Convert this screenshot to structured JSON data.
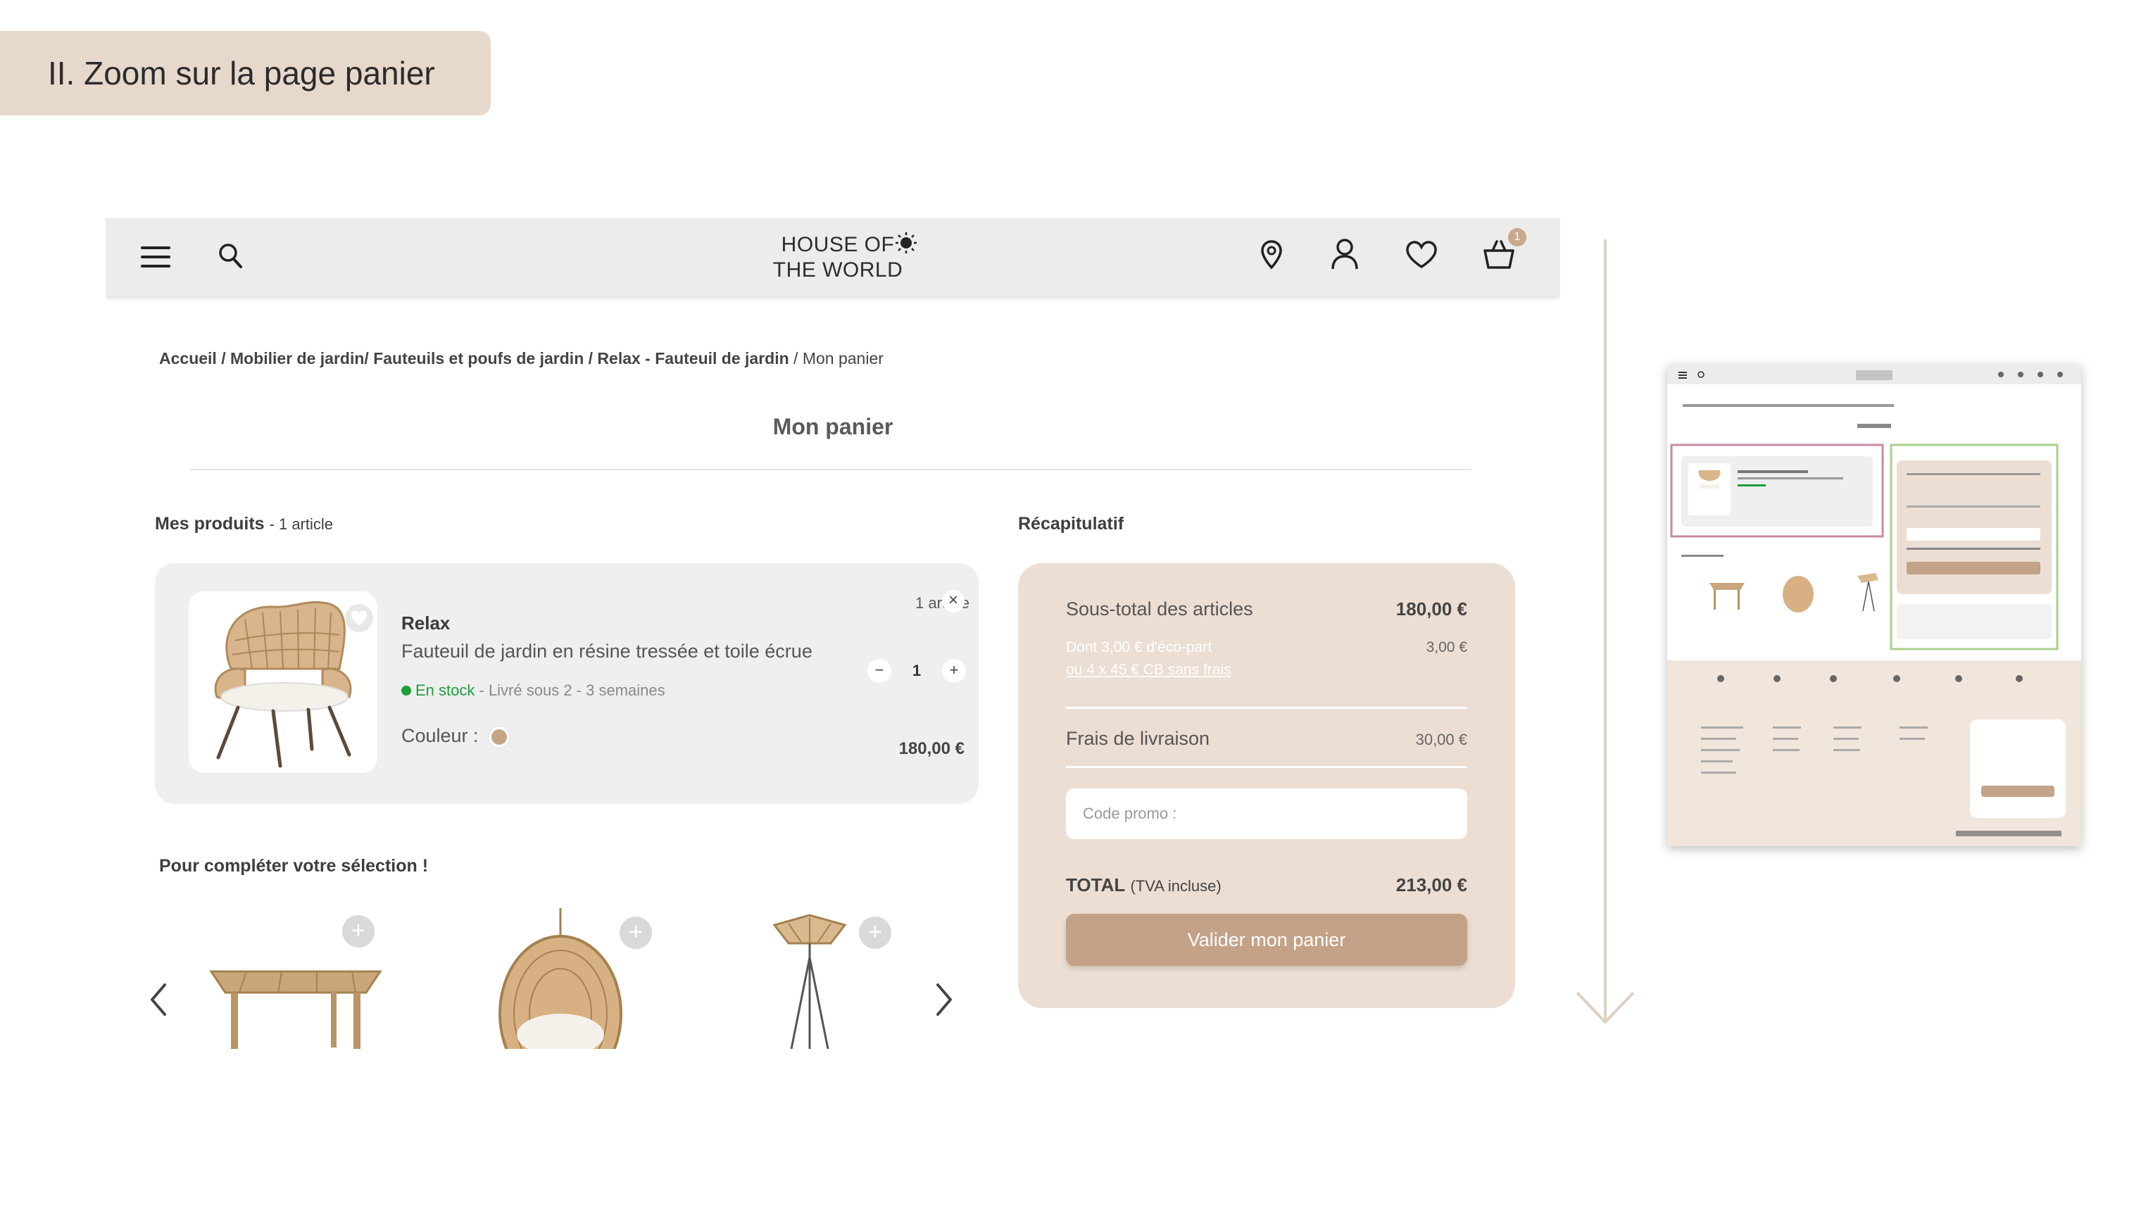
{
  "slide": {
    "title": "II. Zoom sur la page panier"
  },
  "header": {
    "logo_line1": "HOUSE OF",
    "logo_line2": "THE WORLD",
    "cart_count": "1",
    "icons": [
      "menu-icon",
      "search-icon",
      "location-pin-icon",
      "user-icon",
      "heart-icon",
      "basket-icon"
    ]
  },
  "breadcrumb": {
    "items": [
      "Accueil",
      "Mobilier de jardin",
      "Fauteuils et poufs de jardin",
      "Relax - Fauteuil de jardin"
    ],
    "current": "Mon panier"
  },
  "page": {
    "title": "Mon panier"
  },
  "products": {
    "heading": "Mes produits",
    "count": "- 1 article",
    "item": {
      "name": "Relax",
      "description": "Fauteuil de jardin en résine tressée et toile écrue",
      "stock": "En stock",
      "delivery": "- Livré sous 2 - 3 semaines",
      "color_label": "Couleur :",
      "qty_label": "1 article",
      "quantity": "1",
      "price": "180,00 €"
    }
  },
  "recommendations": {
    "heading": "Pour compléter votre sélection !"
  },
  "summary": {
    "heading": "Récapitulatif",
    "subtotal_label": "Sous-total des articles",
    "subtotal_value": "180,00 €",
    "eco_label": "Dont 3,00 € d'éco-part",
    "eco_value": "3,00 €",
    "installments_link": "ou 4 x 45 € CB sans frais",
    "shipping_label": "Frais de livraison",
    "shipping_value": "30,00 €",
    "promo_placeholder": "Code promo :",
    "total_label": "TOTAL",
    "total_note": "(TVA incluse)",
    "total_value": "213,00 €",
    "cta": "Valider mon panier"
  },
  "colors": {
    "accent": "#c4a287",
    "summary_bg": "#ecded3",
    "stock_green": "#1c9e3c",
    "tag_bg": "#e6d9cc"
  }
}
